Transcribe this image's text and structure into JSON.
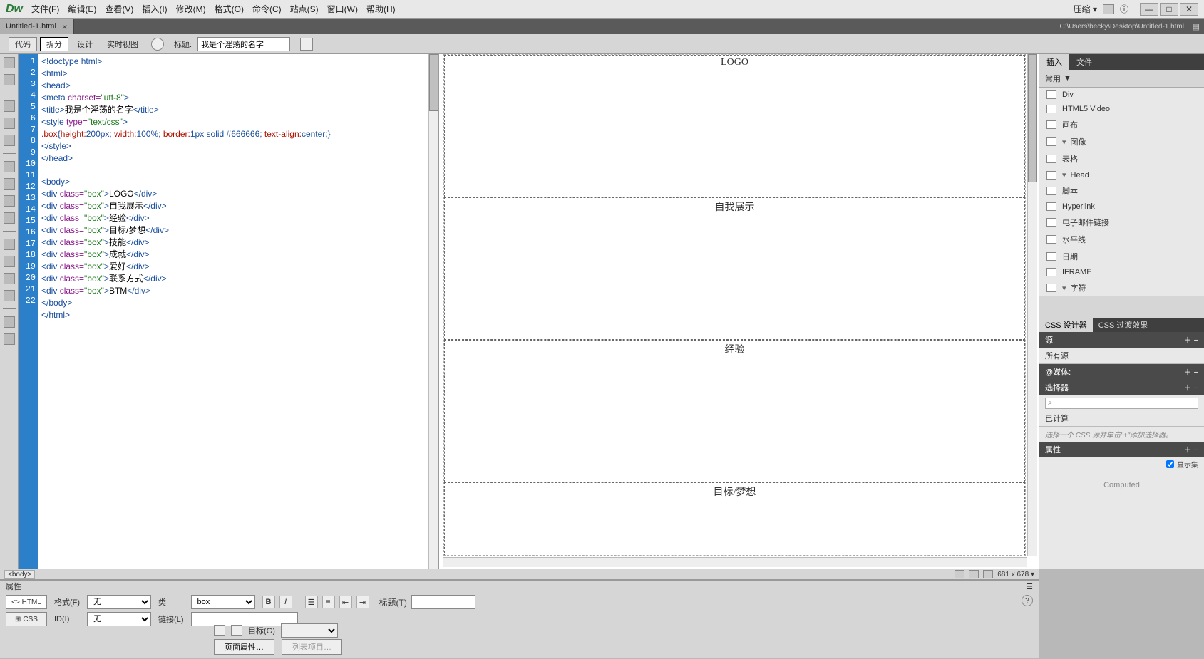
{
  "menubar": {
    "logo": "Dw",
    "items": [
      "文件(F)",
      "编辑(E)",
      "查看(V)",
      "插入(I)",
      "修改(M)",
      "格式(O)",
      "命令(C)",
      "站点(S)",
      "窗口(W)",
      "帮助(H)"
    ],
    "compress": "压缩"
  },
  "tab": {
    "filename": "Untitled-1.html",
    "path": "C:\\Users\\becky\\Desktop\\Untitled-1.html"
  },
  "toolbar": {
    "code": "代码",
    "split": "拆分",
    "design": "设计",
    "live": "实时视图",
    "title_label": "标题:",
    "title_value": "我是个淫荡的名字"
  },
  "code": {
    "lines": 22,
    "l1": "<!doctype html>",
    "l2": "<html>",
    "l3": "<head>",
    "l4a": "<meta ",
    "l4b": "charset=",
    "l4c": "\"utf-8\"",
    "l4d": ">",
    "l5a": "<title>",
    "l5b": "我是个淫荡的名字",
    "l5c": "</title>",
    "l6a": "<style ",
    "l6b": "type=",
    "l6c": "\"text/css\"",
    "l6d": ">",
    "l7a": ".box",
    "l7b": "{",
    "l7c": "height:",
    "l7d": "200px;",
    "l7e": " width:",
    "l7f": "100%;",
    "l7g": " border:",
    "l7h": "1px solid #666666;",
    "l7i": " text-align:",
    "l7j": "center;",
    "l7k": "}",
    "l8": "</style>",
    "l9": "</head>",
    "l11": "<body>",
    "l12a": "<div ",
    "l12b": "class=",
    "l12c": "\"box\"",
    "l12d": ">",
    "l12e": "LOGO",
    "l12f": "</div>",
    "l13e": "自我展示",
    "l14e": "经验",
    "l15e": "目标/梦想",
    "l16e": "技能",
    "l17e": "成就",
    "l18e": "爱好",
    "l19e": "联系方式",
    "l20e": "BTM",
    "l21": "</body>",
    "l22": "</html>"
  },
  "preview": {
    "boxes": [
      "LOGO",
      "自我展示",
      "经验",
      "目标/梦想"
    ]
  },
  "insert": {
    "tab1": "插入",
    "tab2": "文件",
    "dropdown": "常用",
    "items": [
      {
        "label": "Div"
      },
      {
        "label": "HTML5 Video"
      },
      {
        "label": "画布"
      },
      {
        "label": "图像",
        "arrow": true
      },
      {
        "label": "表格"
      },
      {
        "label": "Head",
        "arrow": true
      },
      {
        "label": "脚本"
      },
      {
        "label": "Hyperlink"
      },
      {
        "label": "电子邮件链接"
      },
      {
        "label": "水平线"
      },
      {
        "label": "日期"
      },
      {
        "label": "IFRAME"
      },
      {
        "label": "字符",
        "arrow": true
      }
    ]
  },
  "cssd": {
    "tab1": "CSS 设计器",
    "tab2": "CSS 过渡效果",
    "source": "源",
    "all_sources": "所有源",
    "media": "@媒体:",
    "selectors": "选择器",
    "computed_label": "已计算",
    "hint": "选择一个 CSS 源并单击\"+\"添加选择器。",
    "properties": "属性",
    "show_set": "显示集",
    "computed": "Computed"
  },
  "crumbs": {
    "body": "<body>",
    "dims": "681 x 678"
  },
  "props": {
    "title": "属性",
    "html": "<> HTML",
    "css": "CSS",
    "format_label": "格式(F)",
    "format_value": "无",
    "id_label": "ID(I)",
    "id_value": "无",
    "class_label": "类",
    "class_value": "box",
    "link_label": "链接(L)",
    "title2_label": "标题(T)",
    "target_label": "目标(G)",
    "page_props": "页面属性…",
    "list_items": "列表项目…"
  }
}
